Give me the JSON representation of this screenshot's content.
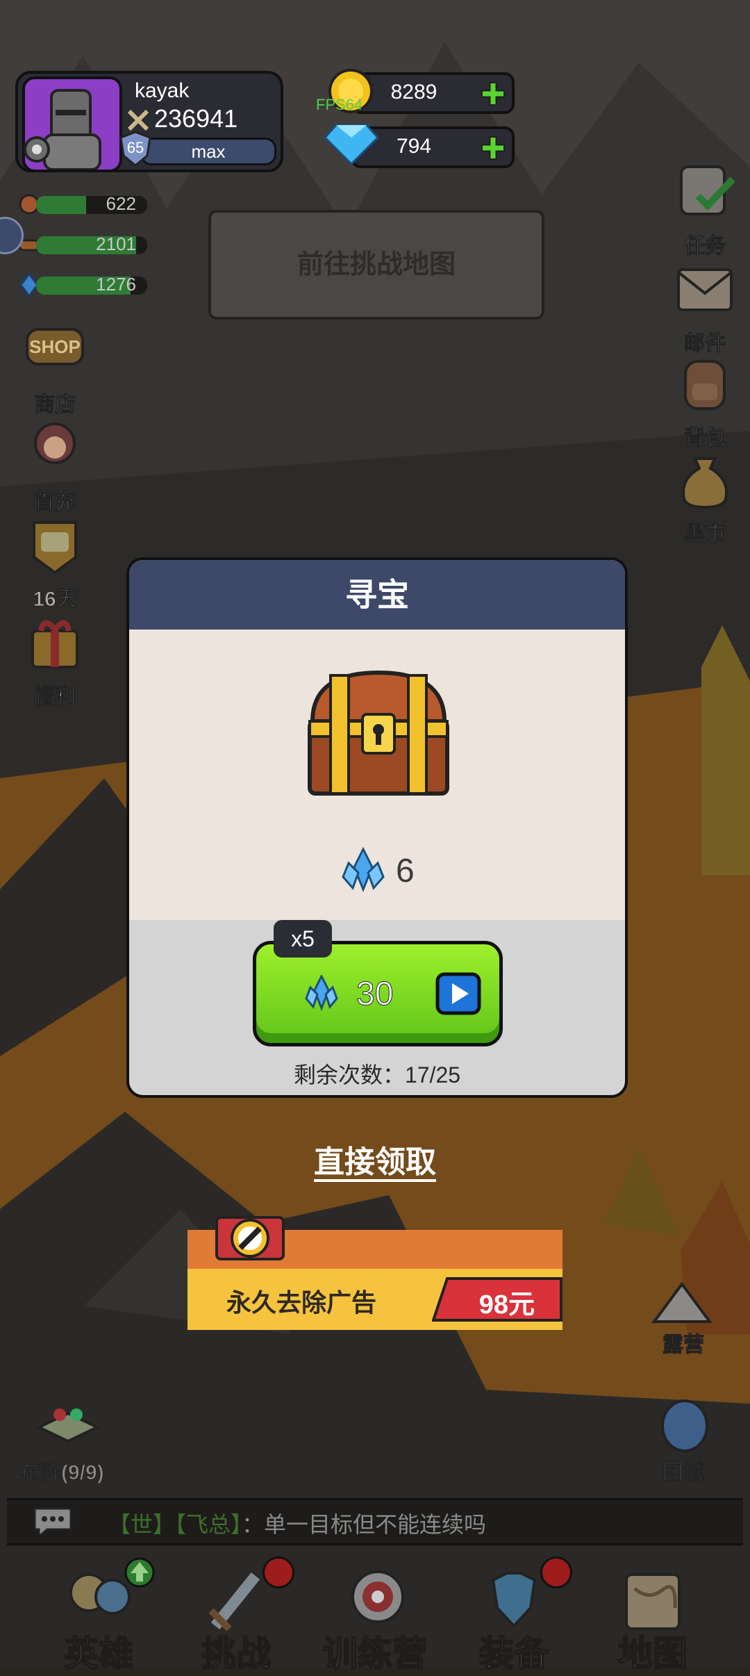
{
  "player": {
    "name": "kayak",
    "power": "236941",
    "level": "65",
    "level_status": "max"
  },
  "resources": {
    "gold": "8289",
    "diamond": "794",
    "fps": "FPS64"
  },
  "stats": [
    {
      "icon": "meat-icon",
      "value": "622",
      "fill": 0.45
    },
    {
      "icon": "wood-icon",
      "value": "2101",
      "fill": 0.9
    },
    {
      "icon": "crystal-icon",
      "value": "1276",
      "fill": 0.85
    }
  ],
  "left_menu": [
    {
      "id": "shop",
      "label": "商店",
      "icon": "shop-icon"
    },
    {
      "id": "first-recharge",
      "label": "首充",
      "icon": "hero-girl-icon"
    },
    {
      "id": "pass",
      "label": "16天",
      "icon": "pass-badge-icon"
    },
    {
      "id": "welfare",
      "label": "福利",
      "icon": "gift-icon"
    }
  ],
  "right_menu": [
    {
      "id": "tasks",
      "label": "任务",
      "icon": "task-board-icon"
    },
    {
      "id": "mail",
      "label": "邮件",
      "icon": "mail-icon"
    },
    {
      "id": "bag",
      "label": "背包",
      "icon": "backpack-icon"
    },
    {
      "id": "black-market",
      "label": "黑市",
      "icon": "money-bag-icon"
    }
  ],
  "go_map": "前往挑战地图",
  "dialog": {
    "title": "寻宝",
    "reward_value": "6",
    "multiplier": "x5",
    "cost": "30",
    "remaining": "剩余次数：17/25"
  },
  "direct_claim": "直接领取",
  "remove_ads": {
    "label": "永久去除广告",
    "price": "98元"
  },
  "map_labels": {
    "camp": "露营",
    "return_city": "回城",
    "formation": "布阵(9/9)"
  },
  "chat": {
    "channel": "【世】",
    "sender": "【飞总】",
    "message": "：单一目标但不能连续吗"
  },
  "nav": [
    {
      "id": "hero",
      "label": "英雄",
      "icon": "heroes-icon",
      "badge": "up"
    },
    {
      "id": "challenge",
      "label": "挑战",
      "icon": "sword-icon",
      "badge": "dot"
    },
    {
      "id": "training",
      "label": "训练营",
      "icon": "target-icon",
      "badge": "none"
    },
    {
      "id": "equipment",
      "label": "装备",
      "icon": "armor-icon",
      "badge": "dot"
    },
    {
      "id": "map",
      "label": "地图",
      "icon": "map-scroll-icon",
      "badge": "none"
    }
  ],
  "colors": {
    "dialog_header": "#3e4969",
    "go_button": "#7ad620",
    "remove_ads_top": "#e07b35",
    "remove_ads_bottom": "#f6c33e",
    "price_tag": "#d9323a"
  }
}
